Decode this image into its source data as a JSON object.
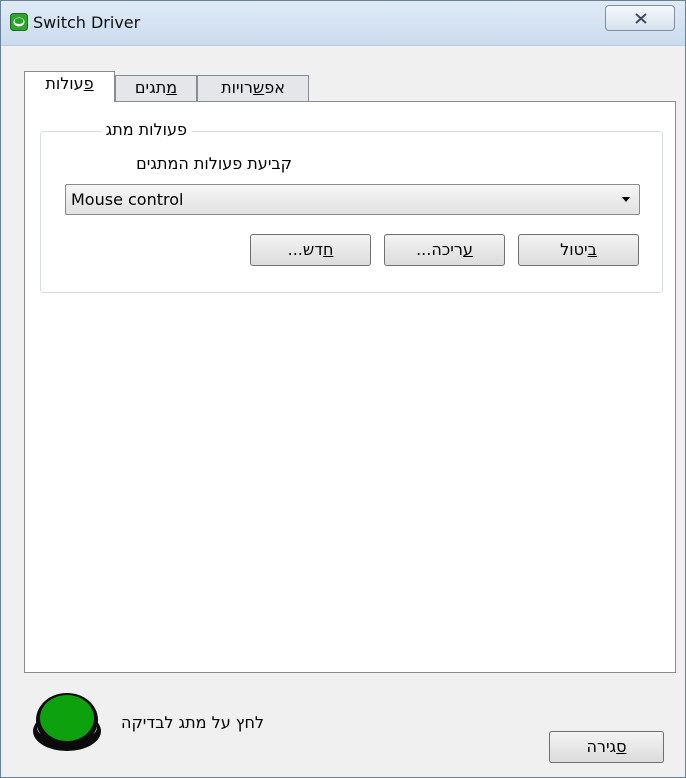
{
  "window": {
    "title": "Switch Driver",
    "close_glyph": "✕",
    "accent": "#1c9b1c"
  },
  "tabs": [
    {
      "prefix": "",
      "underlined": "פ",
      "rest": "עולות",
      "active": true
    },
    {
      "prefix": "",
      "underlined": "מ",
      "rest": "תגים",
      "active": false
    },
    {
      "prefix": "אפ",
      "underlined": "ש",
      "rest": "רויות",
      "active": false
    }
  ],
  "group": {
    "title": "פעולות מתג",
    "label": "קביעת פעולות המתגים",
    "dropdown_value": "Mouse control"
  },
  "buttons": {
    "cancel": {
      "underlined": "ב",
      "rest": "יטול"
    },
    "edit": {
      "underlined": "ע",
      "rest": "ריכה..."
    },
    "new": {
      "underlined": "ח",
      "rest": "דש..."
    }
  },
  "footer": {
    "hint": "לחץ על מתג לבדיקה",
    "close": {
      "underlined": "ס",
      "rest": "גירה"
    },
    "indicator_color": "#0ea10e"
  },
  "icons": {
    "app": "app-icon",
    "close": "close-icon",
    "dropdown": "chevron-down-icon",
    "indicator": "switch-indicator-icon"
  }
}
